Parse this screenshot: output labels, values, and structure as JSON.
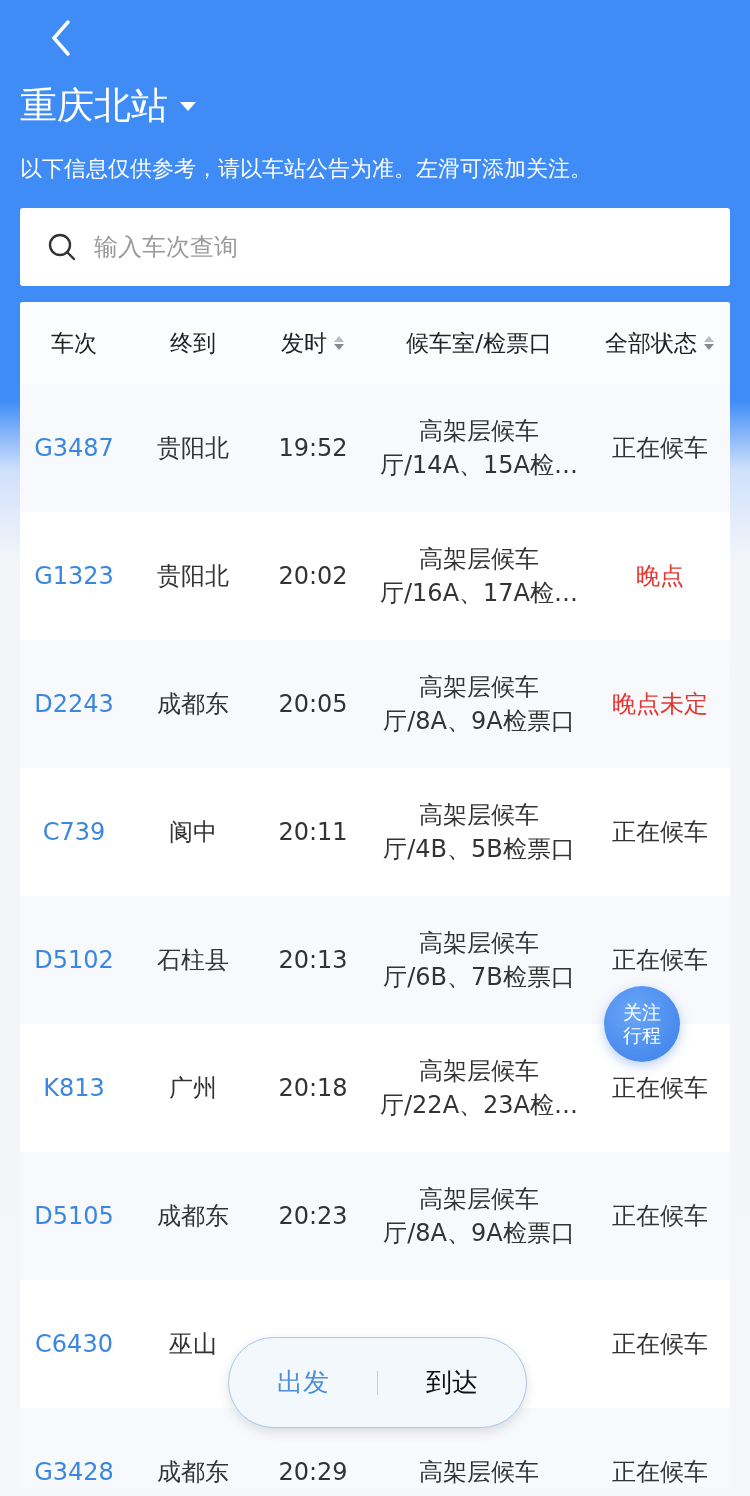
{
  "header": {
    "station": "重庆北站",
    "notice": "以下信息仅供参考，请以车站公告为准。左滑可添加关注。"
  },
  "search": {
    "placeholder": "输入车次查询"
  },
  "table": {
    "columns": [
      {
        "label": "车次",
        "sortable": false
      },
      {
        "label": "终到",
        "sortable": false
      },
      {
        "label": "发时",
        "sortable": true
      },
      {
        "label": "候车室/检票口",
        "sortable": false
      },
      {
        "label": "全部状态",
        "sortable": true
      }
    ],
    "rows": [
      {
        "train": "G3487",
        "dest": "贵阳北",
        "time": "19:52",
        "room": [
          "高架层候车",
          "厅/14A、15A检…"
        ],
        "status": "正在候车",
        "kind": "normal"
      },
      {
        "train": "G1323",
        "dest": "贵阳北",
        "time": "20:02",
        "room": [
          "高架层候车",
          "厅/16A、17A检…"
        ],
        "status": "晚点",
        "kind": "delayed"
      },
      {
        "train": "D2243",
        "dest": "成都东",
        "time": "20:05",
        "room": [
          "高架层候车",
          "厅/8A、9A检票口"
        ],
        "status": "晚点未定",
        "kind": "delayed"
      },
      {
        "train": "C739",
        "dest": "阆中",
        "time": "20:11",
        "room": [
          "高架层候车",
          "厅/4B、5B检票口"
        ],
        "status": "正在候车",
        "kind": "normal"
      },
      {
        "train": "D5102",
        "dest": "石柱县",
        "time": "20:13",
        "room": [
          "高架层候车",
          "厅/6B、7B检票口"
        ],
        "status": "正在候车",
        "kind": "normal"
      },
      {
        "train": "K813",
        "dest": "广州",
        "time": "20:18",
        "room": [
          "高架层候车",
          "厅/22A、23A检…"
        ],
        "status": "正在候车",
        "kind": "normal"
      },
      {
        "train": "D5105",
        "dest": "成都东",
        "time": "20:23",
        "room": [
          "高架层候车",
          "厅/8A、9A检票口"
        ],
        "status": "正在候车",
        "kind": "normal"
      },
      {
        "train": "C6430",
        "dest": "巫山",
        "status": "正在候车",
        "kind": "normal"
      },
      {
        "train": "G3428",
        "dest": "成都东",
        "time": "20:29",
        "room": [
          "高架层候车"
        ],
        "status": "正在候车",
        "kind": "normal"
      }
    ]
  },
  "follow_button": [
    "关注",
    "行程"
  ],
  "toggle": [
    {
      "label": "出发",
      "selected": true
    },
    {
      "label": "到达",
      "selected": false
    }
  ]
}
